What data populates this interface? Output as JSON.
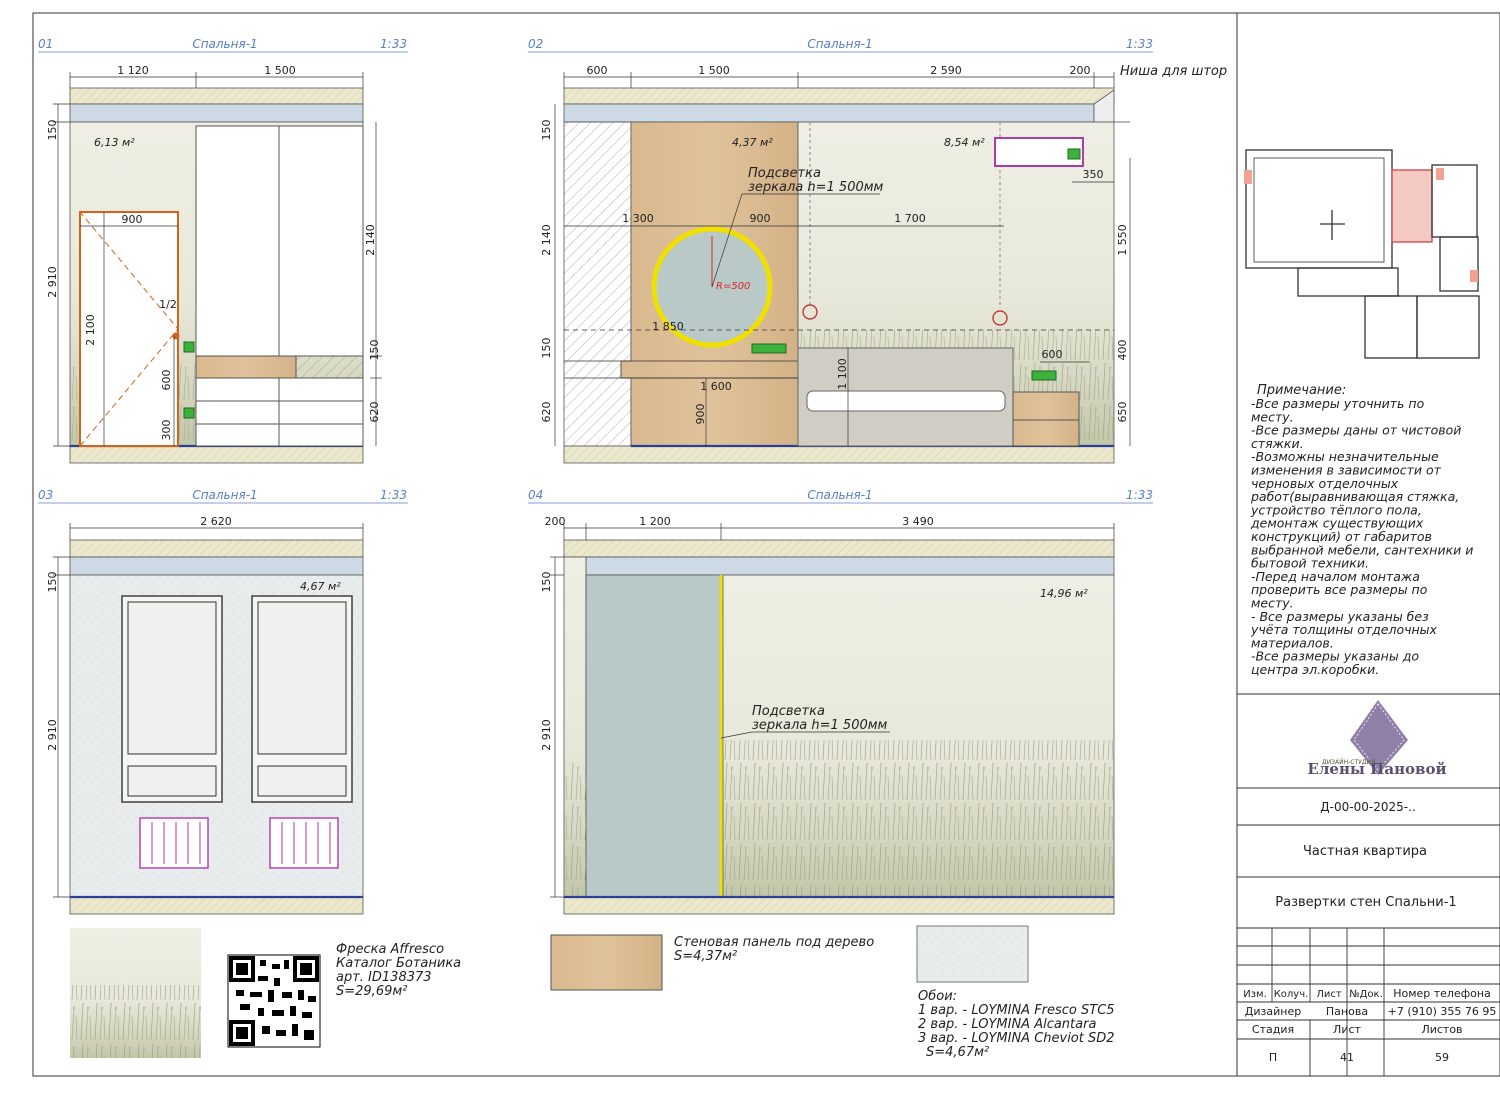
{
  "views": [
    {
      "num": "01",
      "title": "Спальня-1",
      "scale": "1:33"
    },
    {
      "num": "02",
      "title": "Спальня-1",
      "scale": "1:33"
    },
    {
      "num": "03",
      "title": "Спальня-1",
      "scale": "1:33"
    },
    {
      "num": "04",
      "title": "Спальня-1",
      "scale": "1:33"
    }
  ],
  "view1": {
    "dims": [
      "1 120",
      "1 500",
      "150",
      "2 910",
      "900",
      "2 100",
      "1/2",
      "600",
      "300",
      "2 140",
      "150",
      "620"
    ],
    "area": "6,13 м²"
  },
  "view2": {
    "dims": [
      "600",
      "1 500",
      "2 590",
      "200",
      "150",
      "2 140",
      "150",
      "620",
      "1 300",
      "900",
      "1 700",
      "350",
      "1 850",
      "1 600",
      "900",
      "1 100",
      "600",
      "1 550",
      "400",
      "650"
    ],
    "niche": "Ниша для штор",
    "area1": "4,37 м²",
    "area2": "8,54 м²",
    "light1": "Подсветка",
    "light2": "зеркала h=1 500мм",
    "radius": "R=500"
  },
  "view3": {
    "dims": [
      "2 620",
      "150",
      "2 910"
    ],
    "area": "4,67 м²"
  },
  "view4": {
    "dims": [
      "200",
      "1 200",
      "3 490",
      "150",
      "2 910"
    ],
    "area": "14,96 м²",
    "light1": "Подсветка",
    "light2": "зеркала h=1 500мм"
  },
  "legend": {
    "fresco": [
      "Фреска Affresco",
      "Каталог Ботаника",
      "арт. ID138373",
      "S=29,69м²"
    ],
    "panel": [
      "Стеновая панель под дерево",
      "S=4,37м²"
    ],
    "wallpaper": [
      "Обои:",
      "1 вар. - LOYMINA Fresco STC5",
      "2 вар. - LOYMINA Alcantara",
      "3 вар. - LOYMINA Cheviot SD2",
      "S=4,67м²"
    ]
  },
  "notes": {
    "title": "Примечание:",
    "lines": [
      "-Все размеры уточнить по",
      "месту.",
      "-Все размеры даны от чистовой",
      "стяжки.",
      "-Возможны незначительные",
      "изменения в зависимости от",
      "черновых отделочных",
      "работ(выравнивающая стяжка,",
      "устройство тёплого пола,",
      "демонтаж существующих",
      "конструкций) от габаритов",
      "выбранной мебели, сантехники и",
      "бытовой техники.",
      "-Перед началом монтажа",
      "проверить все размеры по",
      "месту.",
      "- Все размеры указаны без",
      "учёта толщины отделочных",
      "материалов.",
      "-Все размеры указаны до",
      "центра эл.коробки."
    ]
  },
  "logo": {
    "small": "ДИЗАЙН-СТУДИЯ",
    "name": "Елены Пановой"
  },
  "titleblock": {
    "code": "Д-00-00-2025-..",
    "project": "Частная квартира",
    "sheet_title": "Развертки стен Спальни-1",
    "h_izm": "Изм.",
    "h_koluch": "Колуч.",
    "h_list": "Лист",
    "h_ndok": "№Док.",
    "h_phone": "Номер телефона",
    "designer_label": "Дизайнер",
    "designer_name": "Панова",
    "phone": "+7 (910) 355 76 95",
    "stage_label": "Стадия",
    "list_label": "Лист",
    "lists_label": "Листов",
    "stage": "П",
    "list": "41",
    "lists": "59"
  },
  "colors": {
    "header": "#5a7fc2",
    "wood": "#d9b98f",
    "mirror_ring": "#f0e000",
    "mirror_fill": "#b9c9c7",
    "ac_outline": "#b03aa8",
    "radiator": "#b03aa8",
    "socket": "#3cb23c",
    "slab": "#e9e6c9",
    "ceiling": "#cdd9e4",
    "floor_line": "#2a3f99"
  }
}
